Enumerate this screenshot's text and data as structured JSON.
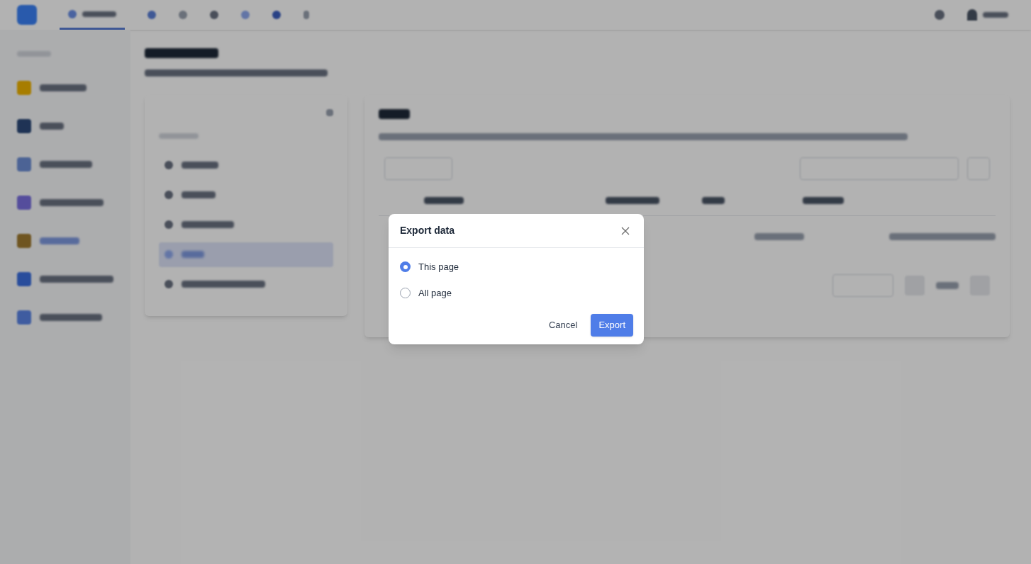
{
  "dialog": {
    "title": "Export data",
    "options": [
      {
        "label": "This page",
        "selected": true
      },
      {
        "label": "All page",
        "selected": false
      }
    ],
    "buttons": [
      {
        "label": "Cancel",
        "kind": "secondary"
      },
      {
        "label": "Export",
        "kind": "primary"
      }
    ]
  }
}
